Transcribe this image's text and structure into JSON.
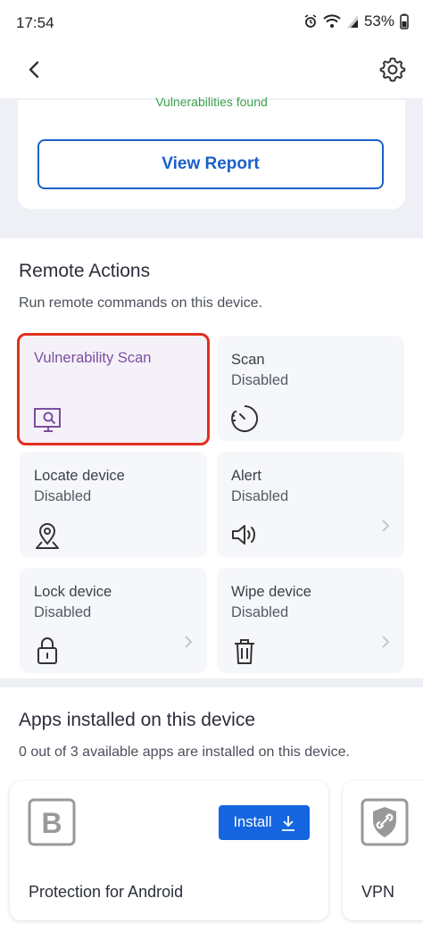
{
  "status_bar": {
    "time": "17:54",
    "battery": "53%"
  },
  "header": {
    "back_icon": "chevron-left-icon",
    "settings_icon": "gear-icon"
  },
  "report": {
    "vulnerabilities_text": "Vulnerabilities found",
    "view_report_label": "View Report"
  },
  "remote_actions": {
    "title": "Remote Actions",
    "subtitle": "Run remote commands on this device.",
    "tiles": [
      {
        "title": "Vulnerability Scan",
        "status": "",
        "icon": "monitor-scan-icon",
        "highlighted": true
      },
      {
        "title": "Scan",
        "status": "Disabled",
        "icon": "timer-icon"
      },
      {
        "title": "Locate device",
        "status": "Disabled",
        "icon": "location-pin-icon"
      },
      {
        "title": "Alert",
        "status": "Disabled",
        "icon": "speaker-icon"
      },
      {
        "title": "Lock device",
        "status": "Disabled",
        "icon": "lock-icon"
      },
      {
        "title": "Wipe device",
        "status": "Disabled",
        "icon": "trash-icon"
      }
    ]
  },
  "apps": {
    "title": "Apps installed on this device",
    "subtitle": "0 out of 3 available apps are installed on this device.",
    "items": [
      {
        "name": "Protection for Android",
        "install_label": "Install",
        "icon": "bitdefender-b-icon"
      },
      {
        "name": "VPN",
        "icon": "shield-link-icon"
      }
    ]
  },
  "colors": {
    "accent": "#1565e0",
    "highlight_border": "#e0301e",
    "purple": "#7b4e9f",
    "success": "#3aa04b"
  }
}
